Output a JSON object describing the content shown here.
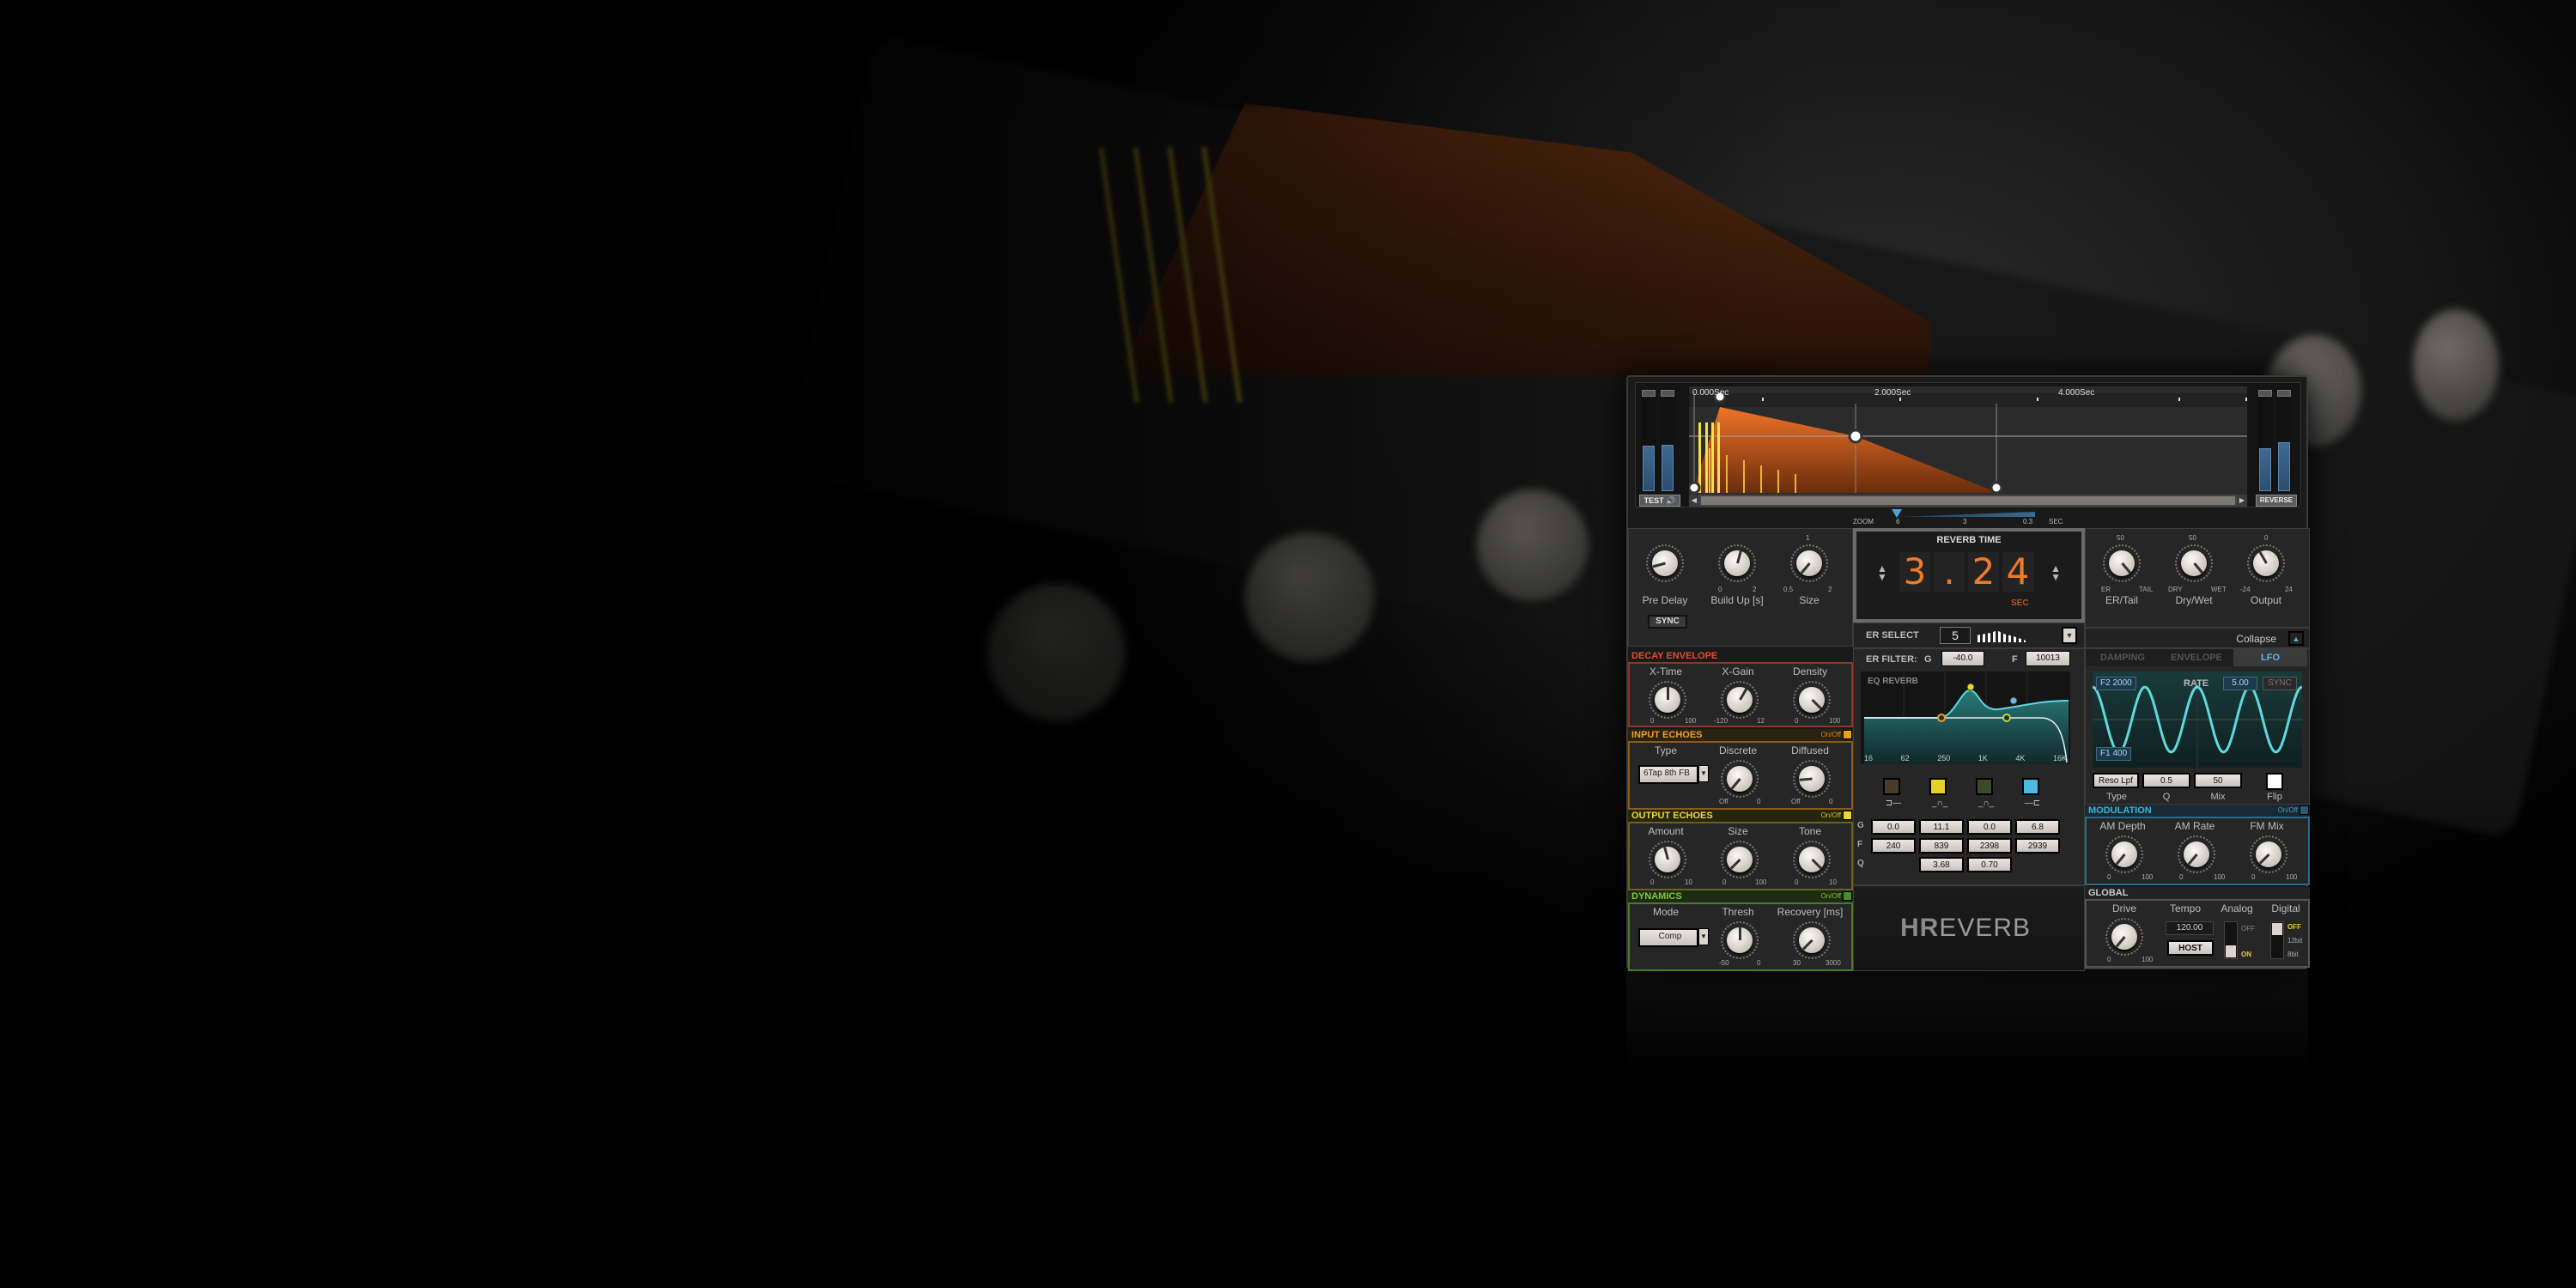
{
  "plugin": {
    "name": "HReverb",
    "logo_h": "HR",
    "logo_rest": "EVERB"
  },
  "envelope_display": {
    "time_labels": [
      "0.000Sec",
      "2.000Sec",
      "4.000Sec"
    ],
    "test_label": "TEST",
    "reverse_label": "REVERSE",
    "input_meter_levels": [
      0.45,
      0.46
    ],
    "output_meter_levels": [
      0.42,
      0.48
    ]
  },
  "zoom": {
    "label": "ZOOM",
    "ticks": [
      "6",
      "3",
      "0.3"
    ],
    "unit": "SEC"
  },
  "reverb_time": {
    "title": "REVERB TIME",
    "digits": [
      "3",
      ".",
      "2",
      "4"
    ],
    "unit": "SEC"
  },
  "er_select": {
    "label": "ER SELECT",
    "value": "5"
  },
  "top_left": {
    "knobs": [
      {
        "label": "Pre Delay",
        "min": "",
        "max": "",
        "mid": ""
      },
      {
        "label": "Build Up [s]",
        "min": "0",
        "max": "2",
        "mid": ""
      },
      {
        "label": "Size",
        "min": "0.5",
        "max": "2",
        "mid": "1"
      }
    ],
    "sync_label": "SYNC"
  },
  "top_right": {
    "knobs": [
      {
        "label": "ER/Tail",
        "min": "ER",
        "max": "TAIL",
        "mid": "50"
      },
      {
        "label": "Dry/Wet",
        "min": "DRY",
        "max": "WET",
        "mid": "50"
      },
      {
        "label": "Output",
        "min": "-24",
        "max": "24",
        "mid": "0"
      }
    ],
    "collapse_label": "Collapse"
  },
  "decay_envelope": {
    "title": "DECAY ENVELOPE",
    "knobs": [
      {
        "label": "X-Time",
        "min": "0",
        "max": "100"
      },
      {
        "label": "X-Gain",
        "min": "-120",
        "max": "12"
      },
      {
        "label": "Density",
        "min": "0",
        "max": "100"
      }
    ]
  },
  "input_echoes": {
    "title": "INPUT ECHOES",
    "onoff": "On/Off",
    "type_label": "Type",
    "type_value": "6Tap 8th FB",
    "knobs": [
      {
        "label": "Discrete",
        "min": "Off",
        "max": "0"
      },
      {
        "label": "Diffused",
        "min": "Off",
        "max": "0"
      }
    ]
  },
  "output_echoes": {
    "title": "OUTPUT ECHOES",
    "onoff": "On/Off",
    "knobs": [
      {
        "label": "Amount",
        "min": "0",
        "max": "10"
      },
      {
        "label": "Size",
        "min": "0",
        "max": "100"
      },
      {
        "label": "Tone",
        "min": "0",
        "max": "10"
      }
    ]
  },
  "dynamics": {
    "title": "DYNAMICS",
    "onoff": "On/Off",
    "mode_label": "Mode",
    "mode_value": "Comp",
    "knobs": [
      {
        "label": "Thresh",
        "min": "-50",
        "max": "0"
      },
      {
        "label": "Recovery [ms]",
        "min": "30",
        "max": "3000"
      }
    ]
  },
  "er_filter": {
    "label": "ER FILTER:",
    "g_label": "G",
    "g_value": "-40.0",
    "f_label": "F",
    "f_value": "10013"
  },
  "eq": {
    "title": "EQ REVERB",
    "freq_labels": [
      "16",
      "62",
      "250",
      "1K",
      "4K",
      "16K"
    ],
    "row_labels": [
      "G",
      "F",
      "Q"
    ],
    "bands": [
      {
        "g": "0.0",
        "f": "240",
        "q": "",
        "color": "#4a3a28",
        "shape": "low-shelf"
      },
      {
        "g": "11.1",
        "f": "839",
        "q": "3.68",
        "color": "#e8d02a",
        "shape": "peak"
      },
      {
        "g": "0.0",
        "f": "2398",
        "q": "0.70",
        "color": "#3a4a2c",
        "shape": "peak"
      },
      {
        "g": "6.8",
        "f": "2939",
        "q": "",
        "color": "#4fb8e0",
        "shape": "high-shelf"
      }
    ]
  },
  "mod_tabs": {
    "tabs": [
      "DAMPING",
      "ENVELOPE",
      "LFO"
    ],
    "active": "LFO"
  },
  "lfo": {
    "f2_label": "F2",
    "f2_value": "2000",
    "f1_label": "F1",
    "f1_value": "400",
    "rate_label": "RATE",
    "rate_value": "5.00",
    "sync_label": "SYNC",
    "type_value": "Reso Lpf",
    "q_value": "0.5",
    "mix_value": "50",
    "labels": [
      "Type",
      "Q",
      "Mix",
      "Flip"
    ]
  },
  "modulation": {
    "title": "MODULATION",
    "onoff": "On/Off",
    "knobs": [
      {
        "label": "AM Depth",
        "min": "0",
        "max": "100"
      },
      {
        "label": "AM Rate",
        "min": "0",
        "max": "100"
      },
      {
        "label": "FM Mix",
        "min": "0",
        "max": "100"
      }
    ]
  },
  "global": {
    "title": "GLOBAL",
    "drive_label": "Drive",
    "drive_min": "0",
    "drive_max": "100",
    "tempo_label": "Tempo",
    "tempo_value": "120.00",
    "host_label": "HOST",
    "analog_label": "Analog",
    "analog_off": "OFF",
    "analog_on": "ON",
    "digital_label": "Digital",
    "digital_off": "OFF",
    "digital_12": "12bit",
    "digital_8": "8bit"
  },
  "colors": {
    "decay": "#e0502a",
    "input": "#f0a020",
    "output": "#e8d830",
    "dynamics": "#7ecb3a",
    "modulation": "#38b4d8",
    "envelope_fill": "#e06a24",
    "reverb_digits": "#f07a2a"
  }
}
